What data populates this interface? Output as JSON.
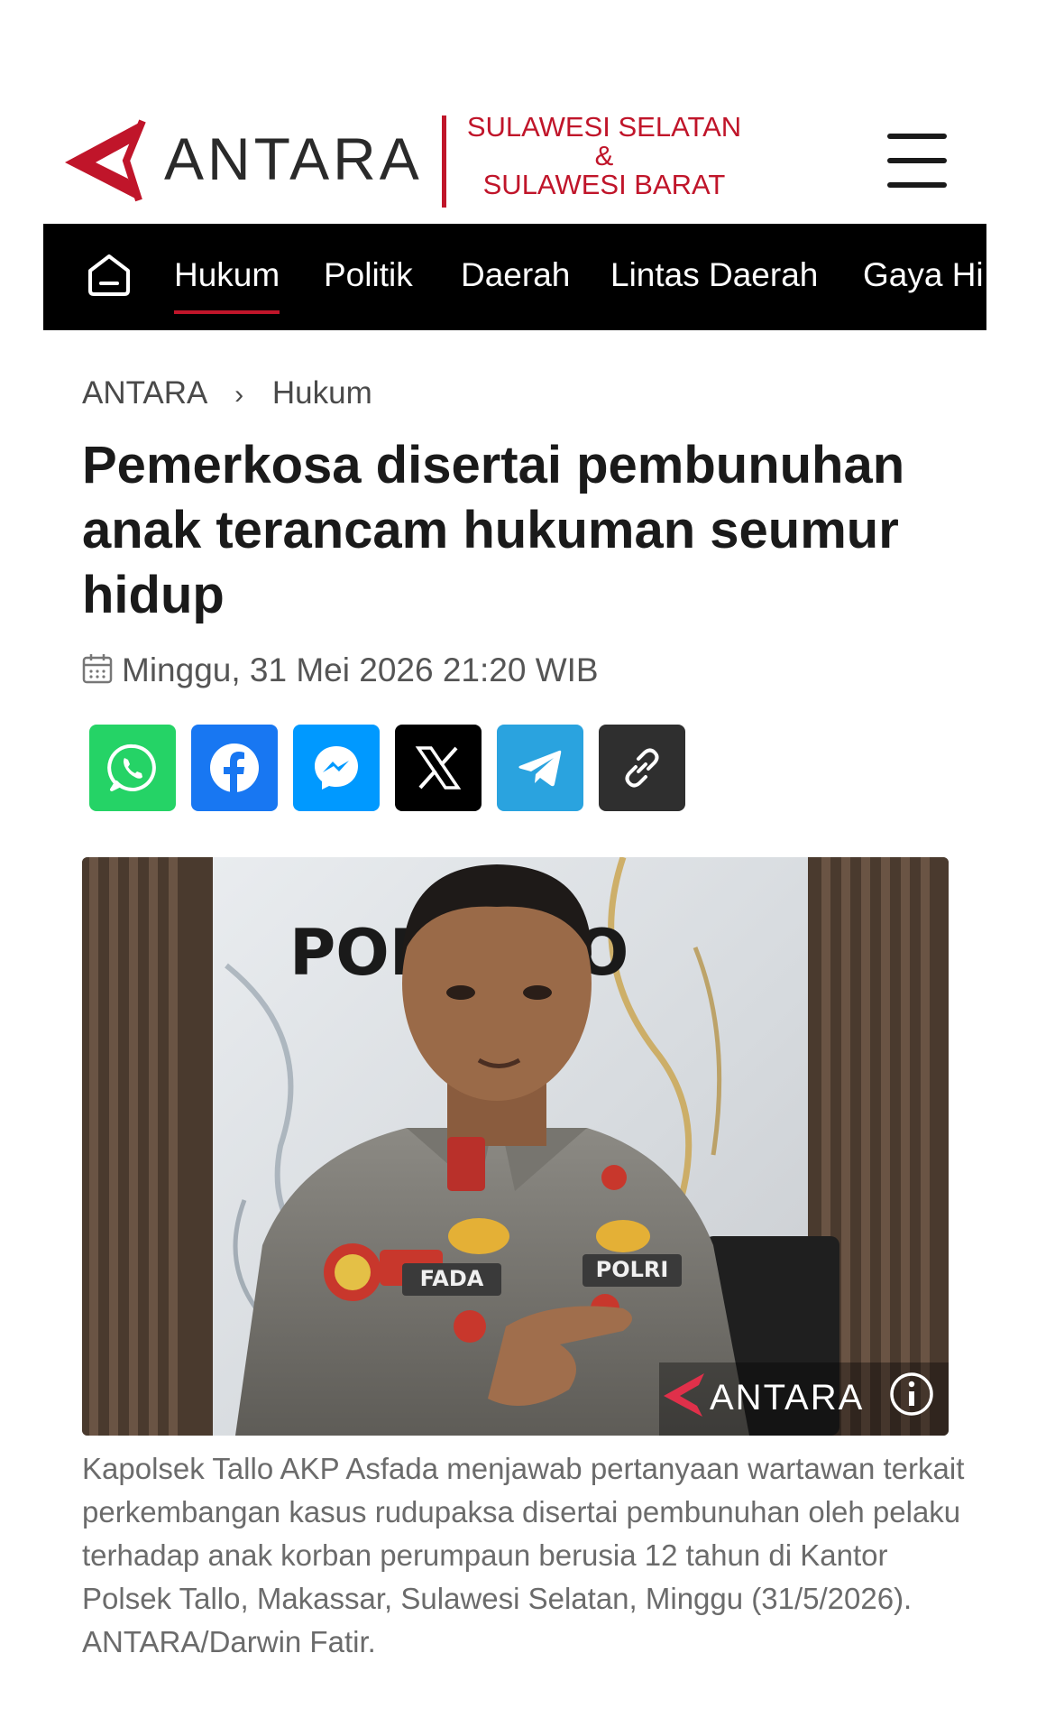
{
  "header": {
    "logo_text": "ANTARA",
    "region_line1": "SULAWESI SELATAN",
    "region_amp": "&",
    "region_line2": "SULAWESI BARAT",
    "menu_icon": "hamburger-menu-icon"
  },
  "nav": {
    "home_icon": "home-icon",
    "items": [
      {
        "label": "Hukum",
        "active": true
      },
      {
        "label": "Politik"
      },
      {
        "label": "Daerah"
      },
      {
        "label": "Lintas Daerah"
      },
      {
        "label": "Gaya Hi"
      }
    ]
  },
  "breadcrumb": {
    "root": "ANTARA",
    "separator": "›",
    "current": "Hukum"
  },
  "article": {
    "title": "Pemerkosa disertai pembunuhan anak terancam hukuman seumur hidup",
    "date": "Minggu, 31 Mei 2026 21:20 WIB",
    "image_watermark": "ANTARA",
    "image_sign_text": "POLS    LLO",
    "badge_left": "FADA",
    "badge_right": "POLRI",
    "caption": "Kapolsek Tallo AKP Asfada menjawab pertanyaan wartawan terkait perkembangan kasus rudupaksa disertai pembunuhan oleh pelaku terhadap anak korban perumpaun berusia 12 tahun di Kantor Polsek Tallo, Makassar, Sulawesi Selatan, Minggu (31/5/2026).  ANTARA/Darwin Fatir."
  },
  "share": {
    "buttons": [
      {
        "icon": "whatsapp-icon",
        "color": "#25d366"
      },
      {
        "icon": "facebook-icon",
        "color": "#1877f2"
      },
      {
        "icon": "messenger-icon",
        "color": "#0099ff"
      },
      {
        "icon": "x-icon",
        "color": "#000000"
      },
      {
        "icon": "telegram-icon",
        "color": "#2aa3df"
      },
      {
        "icon": "copy-link-icon",
        "color": "#2f2f2f"
      }
    ]
  },
  "colors": {
    "brand_red": "#c0152a",
    "nav_bg": "#000000"
  }
}
